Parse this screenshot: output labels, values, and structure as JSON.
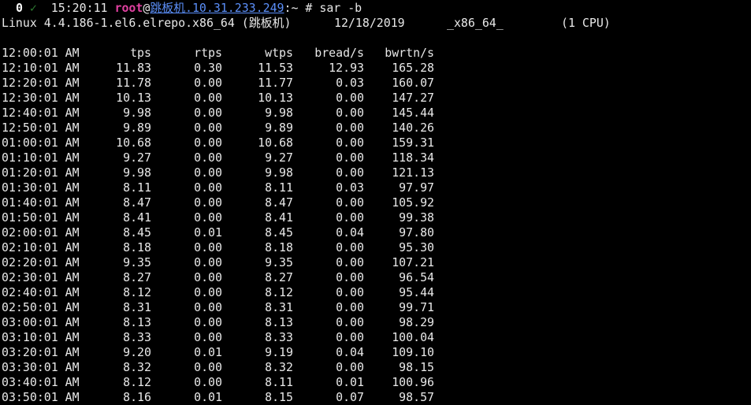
{
  "prompt": {
    "status": "0",
    "check": "✓",
    "time": "15:20:11",
    "user": "root",
    "at": "@",
    "host": "跳板机.10.31.233.249",
    "path": ":~",
    "symbol": "#",
    "command": "sar -b"
  },
  "sysinfo": {
    "kernel": "Linux 4.4.186-1.el6.elrepo.x86_64 (跳板机)",
    "date": "12/18/2019",
    "arch": "_x86_64_",
    "cpus": "(1 CPU)"
  },
  "table": {
    "header": {
      "time": "12:00:01 AM",
      "tps": "tps",
      "rtps": "rtps",
      "wtps": "wtps",
      "bread": "bread/s",
      "bwrtn": "bwrtn/s"
    },
    "rows": [
      {
        "time": "12:10:01 AM",
        "tps": "11.83",
        "rtps": "0.30",
        "wtps": "11.53",
        "bread": "12.93",
        "bwrtn": "165.28"
      },
      {
        "time": "12:20:01 AM",
        "tps": "11.78",
        "rtps": "0.00",
        "wtps": "11.77",
        "bread": "0.03",
        "bwrtn": "160.07"
      },
      {
        "time": "12:30:01 AM",
        "tps": "10.13",
        "rtps": "0.00",
        "wtps": "10.13",
        "bread": "0.00",
        "bwrtn": "147.27"
      },
      {
        "time": "12:40:01 AM",
        "tps": "9.98",
        "rtps": "0.00",
        "wtps": "9.98",
        "bread": "0.00",
        "bwrtn": "145.44"
      },
      {
        "time": "12:50:01 AM",
        "tps": "9.89",
        "rtps": "0.00",
        "wtps": "9.89",
        "bread": "0.00",
        "bwrtn": "140.26"
      },
      {
        "time": "01:00:01 AM",
        "tps": "10.68",
        "rtps": "0.00",
        "wtps": "10.68",
        "bread": "0.00",
        "bwrtn": "159.31"
      },
      {
        "time": "01:10:01 AM",
        "tps": "9.27",
        "rtps": "0.00",
        "wtps": "9.27",
        "bread": "0.00",
        "bwrtn": "118.34"
      },
      {
        "time": "01:20:01 AM",
        "tps": "9.98",
        "rtps": "0.00",
        "wtps": "9.98",
        "bread": "0.00",
        "bwrtn": "121.13"
      },
      {
        "time": "01:30:01 AM",
        "tps": "8.11",
        "rtps": "0.00",
        "wtps": "8.11",
        "bread": "0.03",
        "bwrtn": "97.97"
      },
      {
        "time": "01:40:01 AM",
        "tps": "8.47",
        "rtps": "0.00",
        "wtps": "8.47",
        "bread": "0.00",
        "bwrtn": "105.92"
      },
      {
        "time": "01:50:01 AM",
        "tps": "8.41",
        "rtps": "0.00",
        "wtps": "8.41",
        "bread": "0.00",
        "bwrtn": "99.38"
      },
      {
        "time": "02:00:01 AM",
        "tps": "8.45",
        "rtps": "0.01",
        "wtps": "8.45",
        "bread": "0.04",
        "bwrtn": "97.80"
      },
      {
        "time": "02:10:01 AM",
        "tps": "8.18",
        "rtps": "0.00",
        "wtps": "8.18",
        "bread": "0.00",
        "bwrtn": "95.30"
      },
      {
        "time": "02:20:01 AM",
        "tps": "9.35",
        "rtps": "0.00",
        "wtps": "9.35",
        "bread": "0.00",
        "bwrtn": "107.21"
      },
      {
        "time": "02:30:01 AM",
        "tps": "8.27",
        "rtps": "0.00",
        "wtps": "8.27",
        "bread": "0.00",
        "bwrtn": "96.54"
      },
      {
        "time": "02:40:01 AM",
        "tps": "8.12",
        "rtps": "0.00",
        "wtps": "8.12",
        "bread": "0.00",
        "bwrtn": "95.44"
      },
      {
        "time": "02:50:01 AM",
        "tps": "8.31",
        "rtps": "0.00",
        "wtps": "8.31",
        "bread": "0.00",
        "bwrtn": "99.71"
      },
      {
        "time": "03:00:01 AM",
        "tps": "8.13",
        "rtps": "0.00",
        "wtps": "8.13",
        "bread": "0.00",
        "bwrtn": "98.29"
      },
      {
        "time": "03:10:01 AM",
        "tps": "8.33",
        "rtps": "0.00",
        "wtps": "8.33",
        "bread": "0.00",
        "bwrtn": "100.04"
      },
      {
        "time": "03:20:01 AM",
        "tps": "9.20",
        "rtps": "0.01",
        "wtps": "9.19",
        "bread": "0.04",
        "bwrtn": "109.10"
      },
      {
        "time": "03:30:01 AM",
        "tps": "8.32",
        "rtps": "0.00",
        "wtps": "8.32",
        "bread": "0.00",
        "bwrtn": "98.15"
      },
      {
        "time": "03:40:01 AM",
        "tps": "8.12",
        "rtps": "0.00",
        "wtps": "8.11",
        "bread": "0.01",
        "bwrtn": "100.96"
      },
      {
        "time": "03:50:01 AM",
        "tps": "8.16",
        "rtps": "0.01",
        "wtps": "8.15",
        "bread": "0.07",
        "bwrtn": "98.57"
      }
    ]
  }
}
